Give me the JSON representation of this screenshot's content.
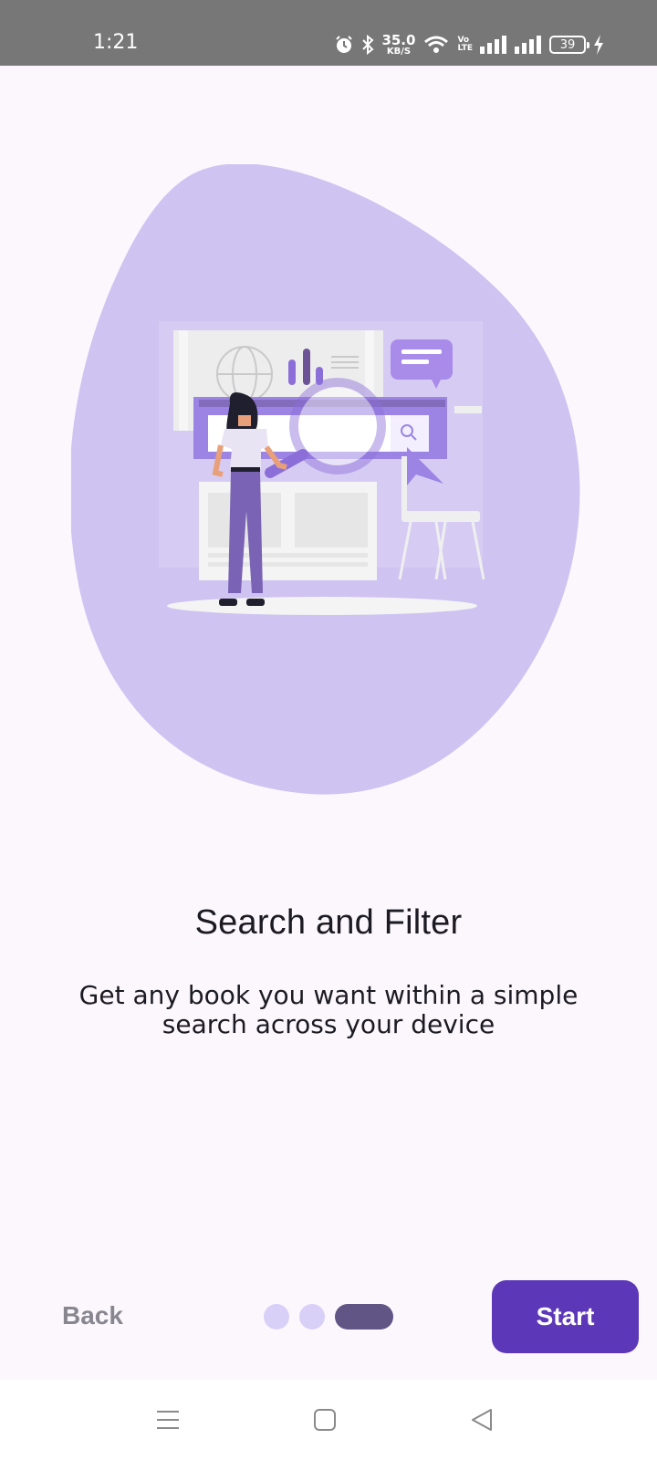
{
  "status_bar": {
    "time": "1:21",
    "net_speed_value": "35.0",
    "net_speed_unit": "KB/S",
    "volte_top": "Vo",
    "volte_bottom": "LTE",
    "battery_level": "39"
  },
  "onboarding": {
    "title": "Search and Filter",
    "description": "Get any book you want within a simple search across your device",
    "page_index": 3,
    "page_count": 3
  },
  "controls": {
    "back_label": "Back",
    "start_label": "Start"
  },
  "colors": {
    "status_bar": "#777777",
    "background": "#fbf7fd",
    "blob": "#cfc3f1",
    "accent": "#5c37b7",
    "dot_inactive": "#d9d0f8",
    "dot_active": "#605585",
    "back_text": "#8a8690"
  },
  "icons": {
    "alarm": "alarm-icon",
    "bluetooth": "bluetooth-icon",
    "wifi": "wifi-icon",
    "signal": "signal-icon",
    "charging": "charging-bolt-icon",
    "nav_menu": "menu-icon",
    "nav_home": "home-icon",
    "nav_back": "back-triangle-icon"
  }
}
